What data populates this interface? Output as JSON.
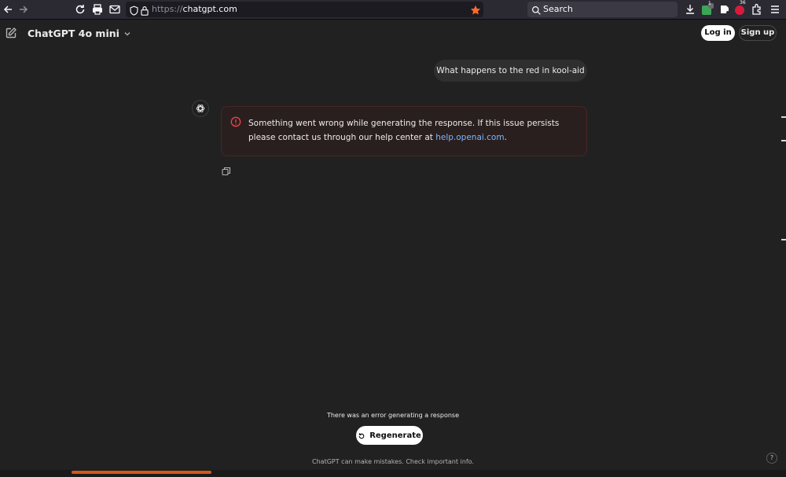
{
  "browser": {
    "url_scheme": "https://",
    "url_host": "chatgpt.com",
    "search_placeholder": "Search",
    "extension_badge_count": "1",
    "adblock_badge_count": "36",
    "star_color": "#ff6a2b"
  },
  "header": {
    "model_name": "ChatGPT 4o mini",
    "login_label": "Log in",
    "signup_label": "Sign up"
  },
  "conversation": {
    "user_message": "What happens to the red in kool-aid",
    "error_message_text": "Something went wrong while generating the response. If this issue persists please contact us through our help center at ",
    "error_link": "help.openai.com",
    "error_message_end": "."
  },
  "footer": {
    "error_note": "There was an error generating a response",
    "regenerate_label": "Regenerate",
    "disclaimer": "ChatGPT can make mistakes. Check important info.",
    "help_label": "?"
  },
  "colors": {
    "background": "#212121",
    "error_accent": "#ef4444",
    "link": "#7ab7ff"
  }
}
